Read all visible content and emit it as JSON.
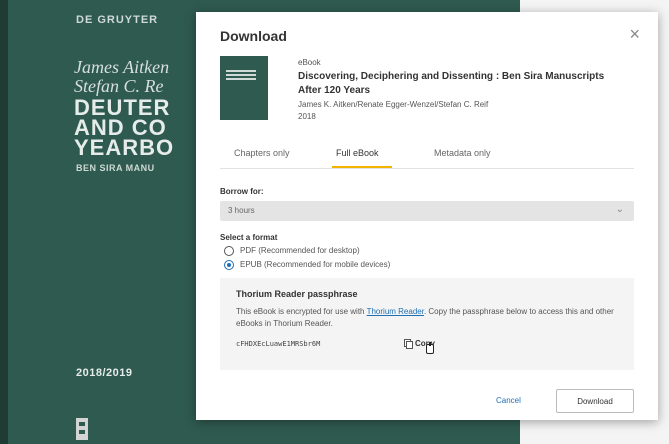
{
  "cover": {
    "publisher": "DE GRUYTER",
    "authors_line1": "James Aitken",
    "authors_line2": "Stefan C. Re",
    "series_line1": "DEUTER",
    "series_line2": "AND CO",
    "series_line3": "YEARBO",
    "subtitle": "BEN SIRA MANU",
    "year": "2018/2019"
  },
  "modal": {
    "title": "Download",
    "close_label": "×",
    "book": {
      "type": "eBook",
      "title": "Discovering, Deciphering and Dissenting : Ben Sira Manuscripts After 120 Years",
      "authors": "James K. Aitken/Renate Egger-Wenzel/Stefan C. Reif",
      "year": "2018"
    },
    "tabs": [
      {
        "label": "Chapters only"
      },
      {
        "label": "Full eBook"
      },
      {
        "label": "Metadata only"
      }
    ],
    "borrow": {
      "label": "Borrow for:",
      "value": "3 hours",
      "chevron": "⌄"
    },
    "format": {
      "label": "Select a format",
      "options": [
        {
          "label": "PDF (Recommended for desktop)"
        },
        {
          "label": "EPUB (Recommended for mobile devices)"
        }
      ]
    },
    "passphrase": {
      "title": "Thorium Reader passphrase",
      "desc_prefix": "This eBook is encrypted for use with",
      "link": "Thorium Reader",
      "desc_suffix": ". Copy the passphrase below to access this and other eBooks in Thorium Reader.",
      "code": "cFHDXEcLuawE1MRSbr6M",
      "copy_label": "Copy"
    },
    "cancel_label": "Cancel",
    "download_label": "Download"
  }
}
